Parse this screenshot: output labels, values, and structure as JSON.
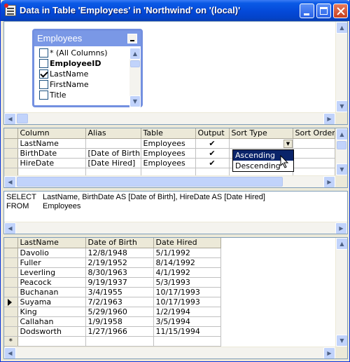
{
  "window": {
    "title": "Data in Table 'Employees' in 'Northwind' on '(local)'"
  },
  "diagram": {
    "table_title": "Employees",
    "fields": [
      {
        "label": "* (All Columns)",
        "checked": false,
        "bold": false
      },
      {
        "label": "EmployeeID",
        "checked": false,
        "bold": true
      },
      {
        "label": "LastName",
        "checked": true,
        "bold": false
      },
      {
        "label": "FirstName",
        "checked": false,
        "bold": false
      },
      {
        "label": "Title",
        "checked": false,
        "bold": false
      }
    ]
  },
  "grid": {
    "headers": [
      "Column",
      "Alias",
      "Table",
      "Output",
      "Sort Type",
      "Sort Order"
    ],
    "rows": [
      {
        "column": "LastName",
        "alias": "",
        "table": "Employees",
        "output": "✔",
        "sort_type": "",
        "sort_order": ""
      },
      {
        "column": "BirthDate",
        "alias": "[Date of Birth]",
        "table": "Employees",
        "output": "✔",
        "sort_type": "",
        "sort_order": ""
      },
      {
        "column": "HireDate",
        "alias": "[Date Hired]",
        "table": "Employees",
        "output": "✔",
        "sort_type": "",
        "sort_order": ""
      }
    ],
    "dropdown_options": [
      "Ascending",
      "Descending"
    ],
    "dropdown_selected": "Ascending"
  },
  "sql": {
    "select_kw": "SELECT",
    "select_text": "LastName, BirthDate AS [Date of Birth], HireDate AS [Date Hired]",
    "from_kw": "FROM",
    "from_text": "Employees"
  },
  "results": {
    "headers": [
      "LastName",
      "Date of Birth",
      "Date Hired"
    ],
    "rows": [
      [
        "Davolio",
        "12/8/1948",
        "5/1/1992"
      ],
      [
        "Fuller",
        "2/19/1952",
        "8/14/1992"
      ],
      [
        "Leverling",
        "8/30/1963",
        "4/1/1992"
      ],
      [
        "Peacock",
        "9/19/1937",
        "5/3/1993"
      ],
      [
        "Buchanan",
        "3/4/1955",
        "10/17/1993"
      ],
      [
        "Suyama",
        "7/2/1963",
        "10/17/1993"
      ],
      [
        "King",
        "5/29/1960",
        "1/2/1994"
      ],
      [
        "Callahan",
        "1/9/1958",
        "3/5/1994"
      ],
      [
        "Dodsworth",
        "1/27/1966",
        "11/15/1994"
      ]
    ],
    "new_row_marker": "*",
    "current_row_index": 5
  }
}
